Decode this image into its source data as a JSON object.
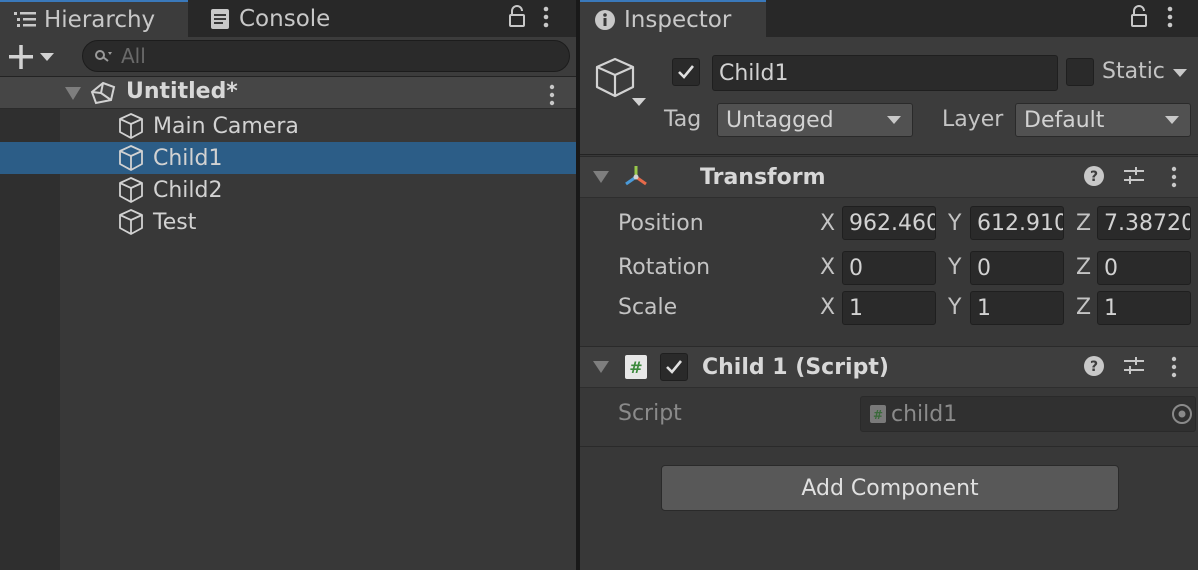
{
  "hierarchy": {
    "tab_hierarchy": "Hierarchy",
    "tab_console": "Console",
    "search_placeholder": "All",
    "scene_name": "Untitled*",
    "items": [
      {
        "label": "Main Camera",
        "selected": false
      },
      {
        "label": "Child1",
        "selected": true
      },
      {
        "label": "Child2",
        "selected": false
      },
      {
        "label": "Test",
        "selected": false
      }
    ]
  },
  "inspector": {
    "tab_label": "Inspector",
    "object_name": "Child1",
    "active_checked": true,
    "static_label": "Static",
    "static_checked": false,
    "tag_label": "Tag",
    "tag_value": "Untagged",
    "layer_label": "Layer",
    "layer_value": "Default",
    "transform": {
      "title": "Transform",
      "position_label": "Position",
      "rotation_label": "Rotation",
      "scale_label": "Scale",
      "position": {
        "x": "962.460",
        "y": "612.910",
        "z": "7.38720"
      },
      "rotation": {
        "x": "0",
        "y": "0",
        "z": "0"
      },
      "scale": {
        "x": "1",
        "y": "1",
        "z": "1"
      },
      "axis_x": "X",
      "axis_y": "Y",
      "axis_z": "Z"
    },
    "script_component": {
      "title": "Child 1 (Script)",
      "enabled": true,
      "script_label": "Script",
      "script_value": "child1"
    },
    "add_component_label": "Add Component"
  },
  "colors": {
    "selection": "#2c5d87",
    "tab_accent": "#3a79bb",
    "script_hash_green": "#3d8a3d"
  }
}
